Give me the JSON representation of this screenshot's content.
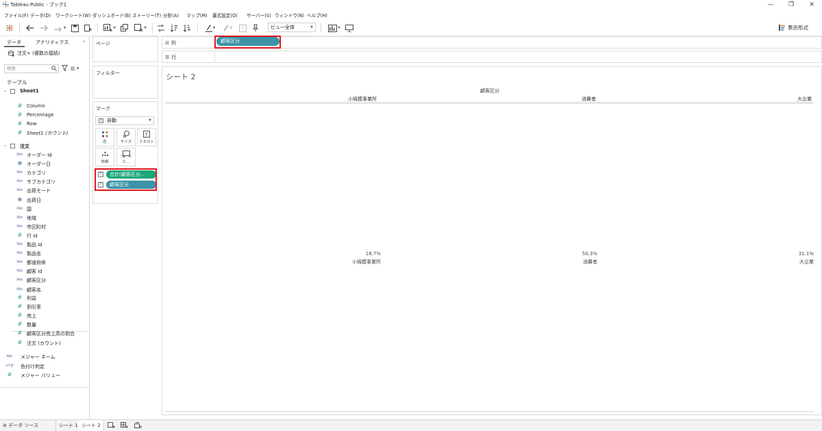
{
  "window": {
    "title": "Tableau Public - ブック1"
  },
  "menu": [
    "ファイル(F)",
    "データ(D)",
    "ワークシート(W)",
    "ダッシュボード(B)",
    "ストーリー(T)",
    "分析(A)",
    "マップ(M)",
    "書式設定(O)",
    "サーバー(S)",
    "ウィンドウ(N)",
    "ヘルプ(H)"
  ],
  "toolbar": {
    "fit_value": "ビュー全体",
    "show_me": "表示形式"
  },
  "data_pane": {
    "tab_data": "データ",
    "tab_analytics": "アナリティクス",
    "datasource": "注文+ (複数の接続)",
    "search_placeholder": "検索",
    "tables_label": "テーブル",
    "sheet1": {
      "name": "Sheet1",
      "fields": [
        "Column",
        "Percentage",
        "Row",
        "Sheet1 (カウント)"
      ]
    },
    "orders": {
      "name": "注文",
      "dimensions": [
        {
          "type": "abc",
          "label": "オーダー Id"
        },
        {
          "type": "date",
          "label": "オーダー日"
        },
        {
          "type": "abc",
          "label": "カテゴリ"
        },
        {
          "type": "abc",
          "label": "サブカテゴリ"
        },
        {
          "type": "abc",
          "label": "出荷モード"
        },
        {
          "type": "date",
          "label": "出荷日"
        },
        {
          "type": "abc",
          "label": "国"
        },
        {
          "type": "abc",
          "label": "地域"
        },
        {
          "type": "abc",
          "label": "市区町村"
        },
        {
          "type": "num",
          "label": "行 Id"
        },
        {
          "type": "abc",
          "label": "製品 Id"
        },
        {
          "type": "abc",
          "label": "製品名"
        },
        {
          "type": "abc",
          "label": "都道府県"
        },
        {
          "type": "abc",
          "label": "顧客 Id"
        },
        {
          "type": "abc",
          "label": "顧客区分"
        },
        {
          "type": "abc",
          "label": "顧客名"
        }
      ],
      "measures": [
        "利益",
        "割引率",
        "売上",
        "数量",
        "顧客区分売上高の割合",
        "注文 (カウント)"
      ]
    },
    "extra": [
      {
        "type": "abc",
        "label": "メジャー ネーム"
      },
      {
        "type": "calc",
        "label": "色付け判定"
      },
      {
        "type": "num",
        "label": "メジャー バリュー"
      }
    ]
  },
  "shelves": {
    "pages": "ページ",
    "filters": "フィルター",
    "marks": "マーク",
    "marks_type": "自動",
    "mark_buttons": [
      "色",
      "サイズ",
      "テキスト",
      "詳細",
      "ツールヒ…"
    ],
    "marks_pills": [
      "合計(顧客区分...",
      "顧客区分"
    ],
    "columns_label": "列",
    "rows_label": "行",
    "columns_pill": "顧客区分"
  },
  "view": {
    "sheet_title": "シート 2",
    "header_field": "顧客区分",
    "columns": [
      {
        "header": "小規模事業所",
        "value": "18.7%",
        "label": "小規模事業所"
      },
      {
        "header": "消費者",
        "value": "50.3%",
        "label": "消費者"
      },
      {
        "header": "大企業",
        "value": "31.1%",
        "label": "大企業"
      }
    ]
  },
  "bottom_tabs": {
    "datasource": "データ ソース",
    "sheet1": "シート 1",
    "sheet2": "シート 2"
  }
}
